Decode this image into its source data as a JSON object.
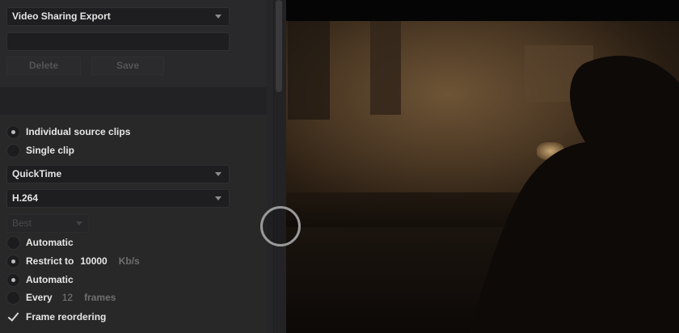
{
  "preset": {
    "selected": "Video Sharing Export",
    "name_value": "",
    "delete_label": "Delete",
    "save_label": "Save"
  },
  "render_mode": {
    "individual_label": "Individual source clips",
    "single_label": "Single clip",
    "selected": "Individual source clips"
  },
  "format": {
    "selected": "QuickTime"
  },
  "codec": {
    "selected": "H.264"
  },
  "quality": {
    "selected": "Best"
  },
  "bitrate": {
    "automatic_label": "Automatic",
    "restrict_label": "Restrict to",
    "restrict_value": "10000",
    "restrict_unit": "Kb/s",
    "selected": "Restrict to"
  },
  "keyframes": {
    "automatic_label": "Automatic",
    "every_label": "Every",
    "every_value": "12",
    "every_unit": "frames",
    "selected": "Automatic"
  },
  "frame_reordering": {
    "label": "Frame reordering",
    "checked": true
  },
  "icons": {
    "dropdown": "chevron-down-icon",
    "radio": "radio-icon",
    "check": "checkmark-icon",
    "playhead": "playhead-icon"
  },
  "colors": {
    "panel": "#262628",
    "viewer": "#050505",
    "text": "#e6e6e6"
  }
}
